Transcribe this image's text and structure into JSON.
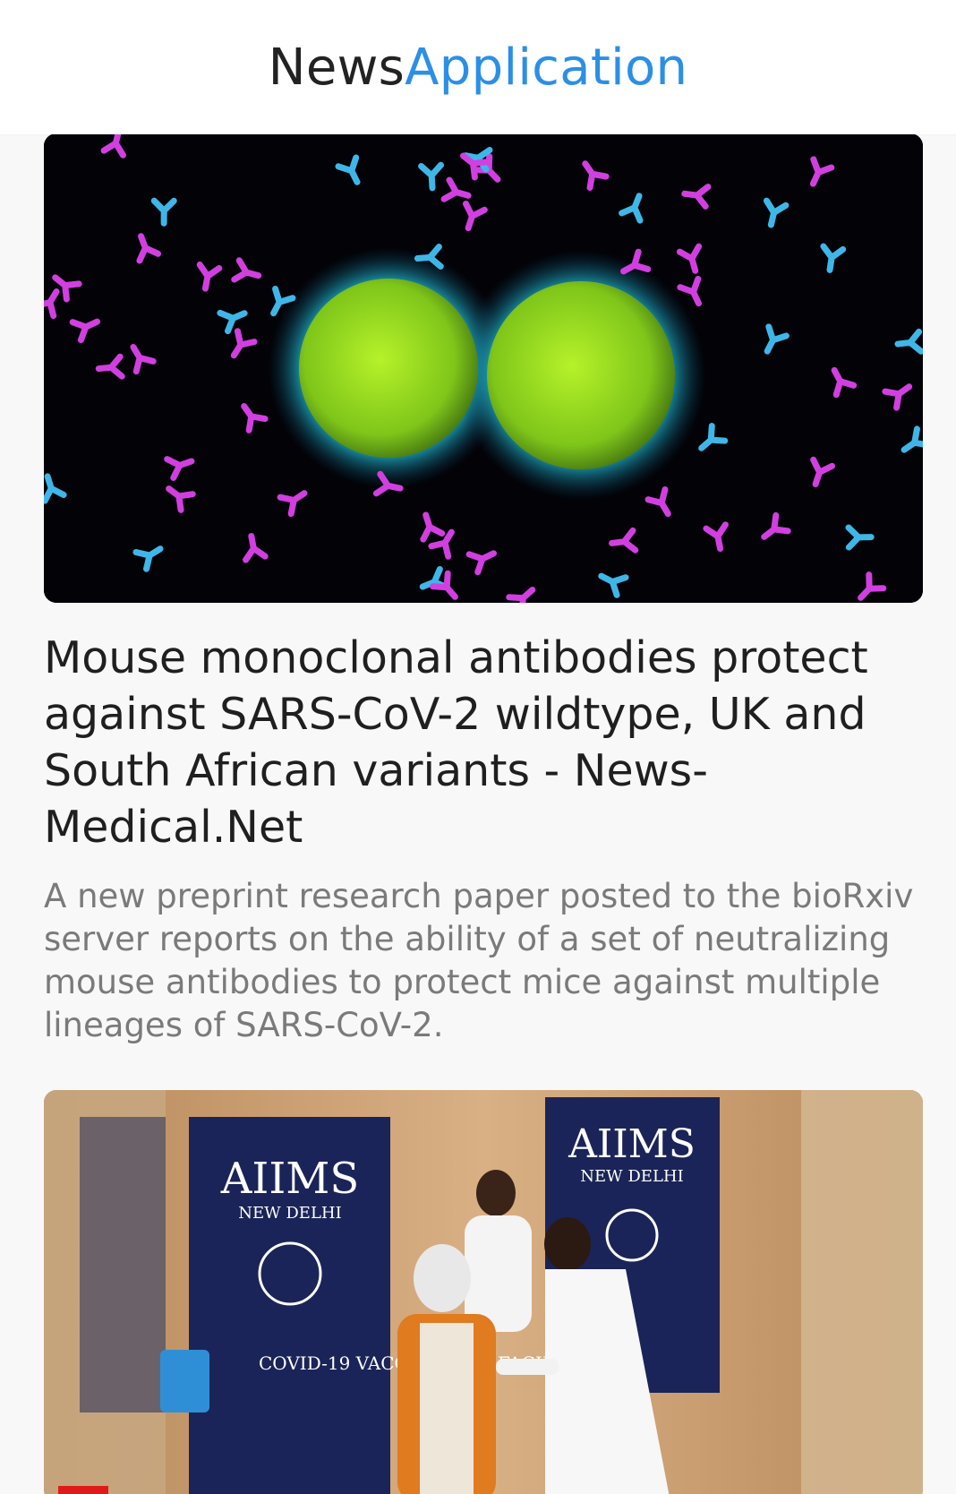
{
  "app_bar": {
    "title_part1": "News",
    "title_part2": "Application",
    "accent_color": "#2b8fe6"
  },
  "articles": [
    {
      "image_alt": "virus-particles-with-antibodies",
      "title": "Mouse monoclonal antibodies protect against SARS-CoV-2 wildtype, UK and South African variants - News-Medical.Net",
      "description": "A new preprint research paper posted to the bioRxiv server reports on the ability of a set of neutralizing mouse antibodies to protect mice against multiple lineages of SARS-CoV-2."
    },
    {
      "image_alt": "covid-vaccination-photo",
      "banner_left_title": "AIIMS",
      "banner_left_sub": "NEW DELHI",
      "banner_left_text": "COVID-19 VACCINATION FACILITY",
      "banner_right_title": "AIIMS",
      "banner_right_sub": "NEW DELHI"
    }
  ]
}
